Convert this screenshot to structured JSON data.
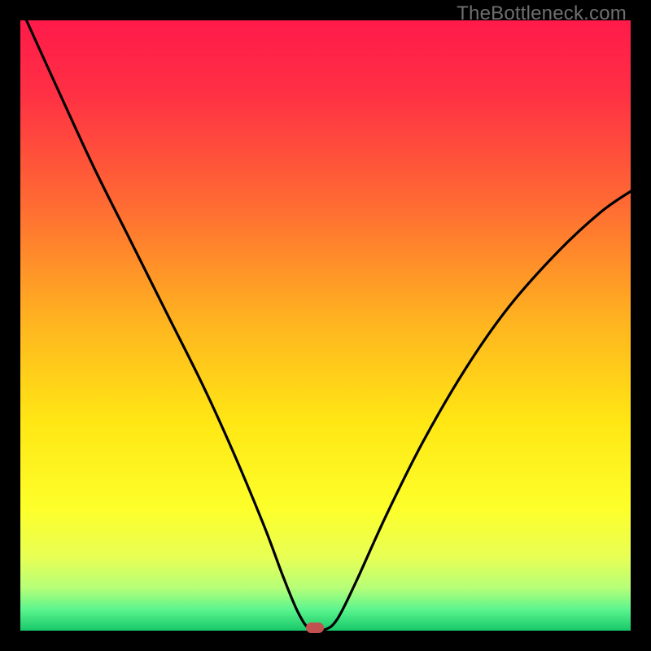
{
  "watermark": "TheBottleneck.com",
  "chart_data": {
    "type": "line",
    "title": "",
    "xlabel": "",
    "ylabel": "",
    "xlim": [
      0,
      100
    ],
    "ylim": [
      0,
      100
    ],
    "background_gradient": {
      "stops": [
        {
          "pos": 0.0,
          "color": "#ff1a4a"
        },
        {
          "pos": 0.12,
          "color": "#ff3044"
        },
        {
          "pos": 0.3,
          "color": "#ff6a33"
        },
        {
          "pos": 0.5,
          "color": "#ffb61f"
        },
        {
          "pos": 0.66,
          "color": "#ffe714"
        },
        {
          "pos": 0.8,
          "color": "#fdff2a"
        },
        {
          "pos": 0.88,
          "color": "#e8ff55"
        },
        {
          "pos": 0.93,
          "color": "#b6ff78"
        },
        {
          "pos": 0.965,
          "color": "#5cf58e"
        },
        {
          "pos": 1.0,
          "color": "#17c869"
        }
      ]
    },
    "series": [
      {
        "name": "bottleneck-curve",
        "color": "#000000",
        "points": [
          {
            "x": 1.0,
            "y": 100.0
          },
          {
            "x": 6.0,
            "y": 89.0
          },
          {
            "x": 12.0,
            "y": 76.0
          },
          {
            "x": 18.0,
            "y": 64.0
          },
          {
            "x": 24.0,
            "y": 52.0
          },
          {
            "x": 30.0,
            "y": 40.0
          },
          {
            "x": 35.0,
            "y": 29.0
          },
          {
            "x": 40.0,
            "y": 17.0
          },
          {
            "x": 43.0,
            "y": 9.0
          },
          {
            "x": 45.5,
            "y": 3.0
          },
          {
            "x": 47.5,
            "y": 0.2
          },
          {
            "x": 50.0,
            "y": 0.2
          },
          {
            "x": 52.0,
            "y": 2.0
          },
          {
            "x": 55.0,
            "y": 8.0
          },
          {
            "x": 60.0,
            "y": 19.0
          },
          {
            "x": 66.0,
            "y": 31.0
          },
          {
            "x": 73.0,
            "y": 43.0
          },
          {
            "x": 80.0,
            "y": 53.0
          },
          {
            "x": 88.0,
            "y": 62.0
          },
          {
            "x": 95.0,
            "y": 68.5
          },
          {
            "x": 100.0,
            "y": 72.0
          }
        ]
      }
    ],
    "marker": {
      "x": 48.3,
      "y": 0.5,
      "color": "#c1514f"
    }
  }
}
